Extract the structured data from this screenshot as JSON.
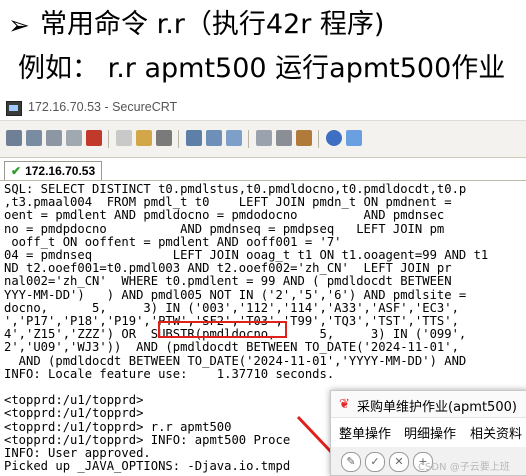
{
  "slide": {
    "bullet": "➢",
    "line1": "常用命令 r.r（执行42r 程序)",
    "line2": "例如： r.r apmt500 运行apmt500作业"
  },
  "window": {
    "title": "172.16.70.53 - SecureCRT",
    "tab_label": "172.16.70.53",
    "toolbar_icons": [
      "connect-icon",
      "quick-connect-icon",
      "tab-icon",
      "reconnect-icon",
      "disconnect-icon",
      "copy-icon",
      "paste-icon",
      "find-icon",
      "print-icon",
      "print-setup-icon",
      "print-icon-2",
      "session-options-icon",
      "global-options-icon",
      "keymap-icon",
      "help-icon",
      "about-icon"
    ]
  },
  "terminal": {
    "lines": [
      "SQL: SELECT DISTINCT t0.pmdlstus,t0.pmdldocno,t0.pmdldocdt,t0.p",
      ",t3.pmaal004  FROM pmdl_t t0    LEFT JOIN pmdn_t ON pmdnent =",
      "oent = pmdlent AND pmdldocno = pmdodocno         AND pmdnsec",
      "no = pmdpdocno          AND pmdnseq = pmdpseq   LEFT JOIN pm",
      " ooff_t ON ooffent = pmdlent AND ooff001 = '7'",
      "04 = pmdnseq           LEFT JOIN ooag_t t1 ON t1.ooagent=99 AND t1",
      "ND t2.ooef001=t0.pmdl003 AND t2.ooef002='zh_CN'  LEFT JOIN pr",
      "nal002='zh_CN'  WHERE t0.pmdlent = 99 AND ( pmdldocdt BETWEEN",
      "YYY-MM-DD')   ) AND pmdl005 NOT IN ('2','5','6') AND pmdlsite =",
      "docno,      5,     3) IN ('003','112','114','A33','ASF','EC3',",
      "','P17','P18','P19','PTW','SF2','T03','T99','TQ3','TST','TTS',",
      "4','Z15','ZZZ') OR  SUBSTR(pmdldocno,      5,     3) IN ('099',",
      "2','U09','WJ3'))  AND (pmdldocdt BETWEEN TO_DATE('2024-11-01',",
      "  AND (pmdldocdt BETWEEN TO_DATE('2024-11-01','YYYY-MM-DD') AND",
      "INFO: Locale feature use:    1.37710 seconds.",
      "",
      "<topprd:/u1/topprd>",
      "<topprd:/u1/topprd>",
      "<topprd:/u1/topprd> r.r apmt500",
      "<topprd:/u1/topprd> INFO: apmt500 Proce",
      "INFO: User approved.",
      "Picked up _JAVA_OPTIONS: -Djava.io.tmpd"
    ]
  },
  "popup": {
    "logo": "❦",
    "title": "采购单维护作业(apmt500)",
    "menus": [
      "整单操作",
      "明细操作",
      "相关资料"
    ]
  },
  "watermark": "CSDN @子云要上班",
  "colors": {
    "highlight": "#e0211b",
    "tab_check": "#2c9a2c"
  }
}
